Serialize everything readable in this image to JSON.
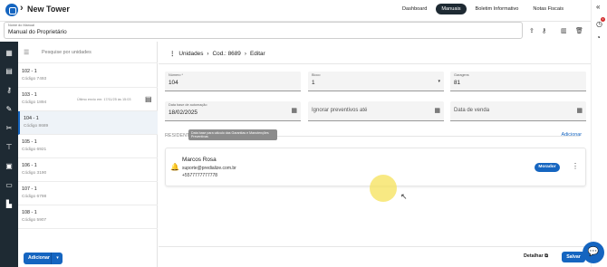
{
  "header": {
    "title": "New Tower",
    "tabs": [
      {
        "label": "Dashboard",
        "active": false
      },
      {
        "label": "Manuais",
        "active": true
      },
      {
        "label": "Boletim Informativo",
        "active": false
      },
      {
        "label": "Notas Fiscais",
        "active": false
      }
    ],
    "notification_count": "1"
  },
  "manual": {
    "label": "Nome do Manual",
    "value": "Manual do Proprietário"
  },
  "units_panel": {
    "search_placeholder": "Pesquise por unidades",
    "items": [
      {
        "name": "102 - 1",
        "code": "Código 7493",
        "sent": ""
      },
      {
        "name": "103 - 1",
        "code": "Código 1894",
        "sent": "Último envio em: 17/11/25 às 15:03"
      },
      {
        "name": "104 - 1",
        "code": "Código 8689",
        "sent": ""
      },
      {
        "name": "105 - 1",
        "code": "Código 6921",
        "sent": ""
      },
      {
        "name": "106 - 1",
        "code": "Código 3190",
        "sent": ""
      },
      {
        "name": "107 - 1",
        "code": "Código 6798",
        "sent": ""
      },
      {
        "name": "108 - 1",
        "code": "Código 5907",
        "sent": ""
      }
    ],
    "add_label": "Adicionar"
  },
  "breadcrumb": {
    "root": "Unidades",
    "code": "Cod.: 8689",
    "current": "Editar"
  },
  "form": {
    "numero_label": "Número *",
    "numero_value": "104",
    "bloco_label": "Bloco",
    "bloco_value": "1",
    "garagens_label": "Garagens",
    "garagens_value": "81",
    "data_base_label": "Data base de automação",
    "data_base_value": "18/02/2025",
    "ignorar_placeholder": "Ignorar preventivos até",
    "data_venda_placeholder": "Data de venda"
  },
  "tooltip": "Data base para cálculo das Garantias e Manutenções Preventivas",
  "residents": {
    "section_label": "RESIDENTES",
    "add_label": "Adicionar",
    "items": [
      {
        "name": "Marcos Rosa",
        "email": "suporte@predialize.com.br",
        "phone": "+5577777777778",
        "role": "Morador"
      }
    ]
  },
  "footer": {
    "detail_label": "Detalhar",
    "save_label": "Salvar"
  },
  "colors": {
    "accent": "#1565c0",
    "nav_dark": "#1e2a33"
  }
}
